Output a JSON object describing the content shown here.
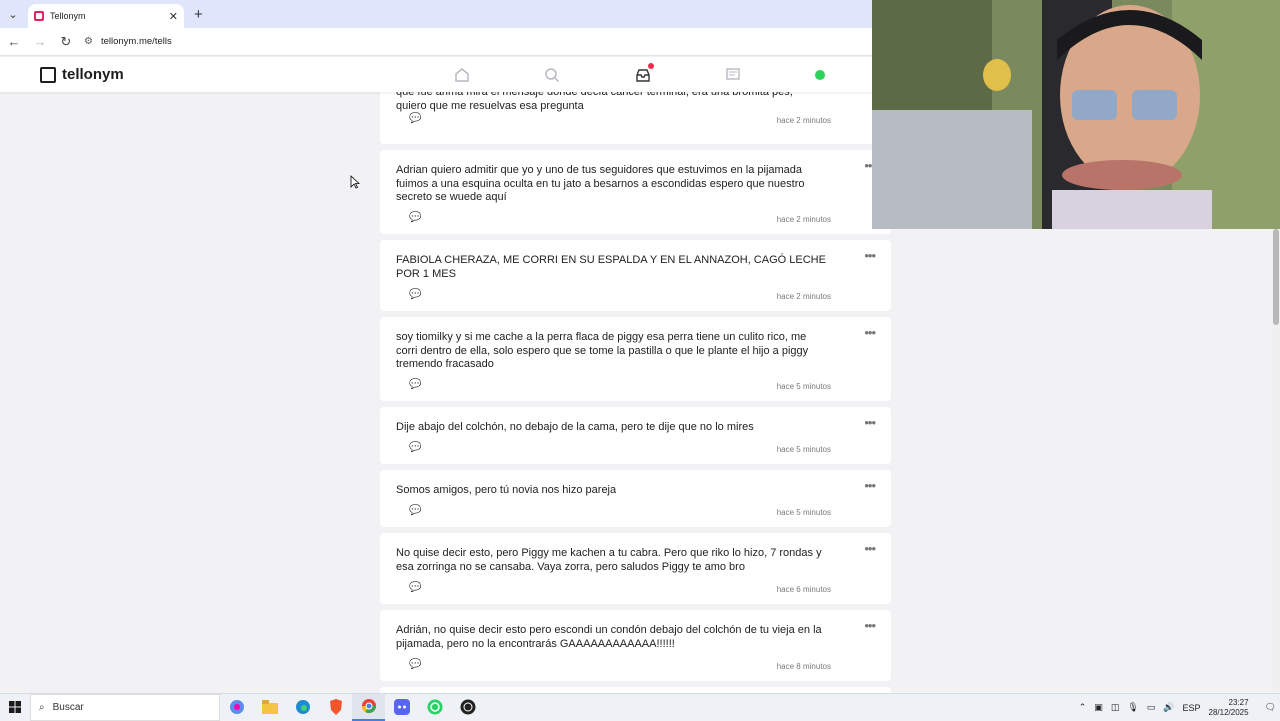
{
  "browser": {
    "tab_title": "Tellonym",
    "tab_close": "✕",
    "new_tab": "+",
    "url": "tellonym.me/tells"
  },
  "site": {
    "logo": "tellonym",
    "accent": "#ee2a4f",
    "online": "#2ad35a"
  },
  "tells": [
    {
      "text": "que fue arima mira el mensaje donde decía cáncer terminal, era una bromita pes, quiero que me resuelvas esa pregunta",
      "time": "hace 2 minutos"
    },
    {
      "text": "Adrian quiero admitir que yo y uno de tus seguidores que estuvimos en la pijamada fuimos a una esquina oculta en tu jato a besarnos a escondidas espero que nuestro secreto se wuede aquí",
      "time": "hace 2 minutos"
    },
    {
      "text": "FABIOLA CHERAZA, ME CORRI EN SU ESPALDA Y EN EL ANNAZOH, CAGÓ LECHE POR 1 MES",
      "time": "hace 2 minutos"
    },
    {
      "text": "soy tiomilky y si me cache a la perra flaca de piggy esa perra tiene un culito rico, me corri dentro de ella, solo espero que se tome la pastilla o que le plante el hijo a piggy tremendo fracasado",
      "time": "hace 5 minutos"
    },
    {
      "text": "Dije abajo del colchón, no debajo de la cama, pero te dije que no lo mires",
      "time": "hace 5 minutos"
    },
    {
      "text": "Somos amigos, pero tú novia nos hizo pareja",
      "time": "hace 5 minutos"
    },
    {
      "text": "No quise decir esto, pero Piggy me kachen a tu cabra. Pero que riko lo hizo, 7 rondas y esa zorringa no se cansaba. Vaya zorra, pero saludos Piggy te amo bro",
      "time": "hace 6 minutos"
    },
    {
      "text": "Adrián, no quise decir esto pero escondi un condón debajo del colchón de tu vieja en la pijamada, pero no la encontrarás GAAAAAAAAAAAA!!!!!!",
      "time": "hace 8 minutos"
    }
  ],
  "taskbar": {
    "search_placeholder": "Buscar",
    "language": "ESP",
    "time": "23:27",
    "date": "28/12/2025"
  }
}
